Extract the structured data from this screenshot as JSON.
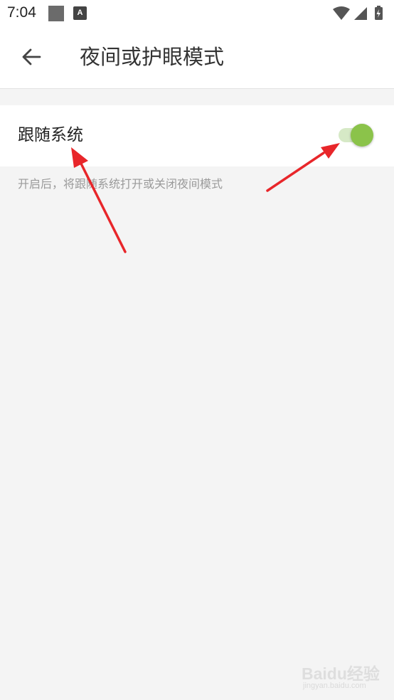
{
  "status_bar": {
    "time": "7:04",
    "icons": [
      "notification-square-icon",
      "a-badge-icon",
      "wifi-icon",
      "signal-icon",
      "battery-icon"
    ],
    "a_badge_text": "A"
  },
  "app_bar": {
    "back_icon": "arrow-left-icon",
    "title": "夜间或护眼模式"
  },
  "setting": {
    "label": "跟随系统",
    "toggle_on": true,
    "description": "开启后，将跟随系统打开或关闭夜间模式"
  },
  "colors": {
    "toggle_thumb": "#8bc34a",
    "toggle_track": "#d6e9c6",
    "annotation_arrow": "#e8262a",
    "background": "#f4f4f4"
  },
  "watermark": {
    "text": "Baidu经验",
    "url": "jingyan.baidu.com"
  }
}
